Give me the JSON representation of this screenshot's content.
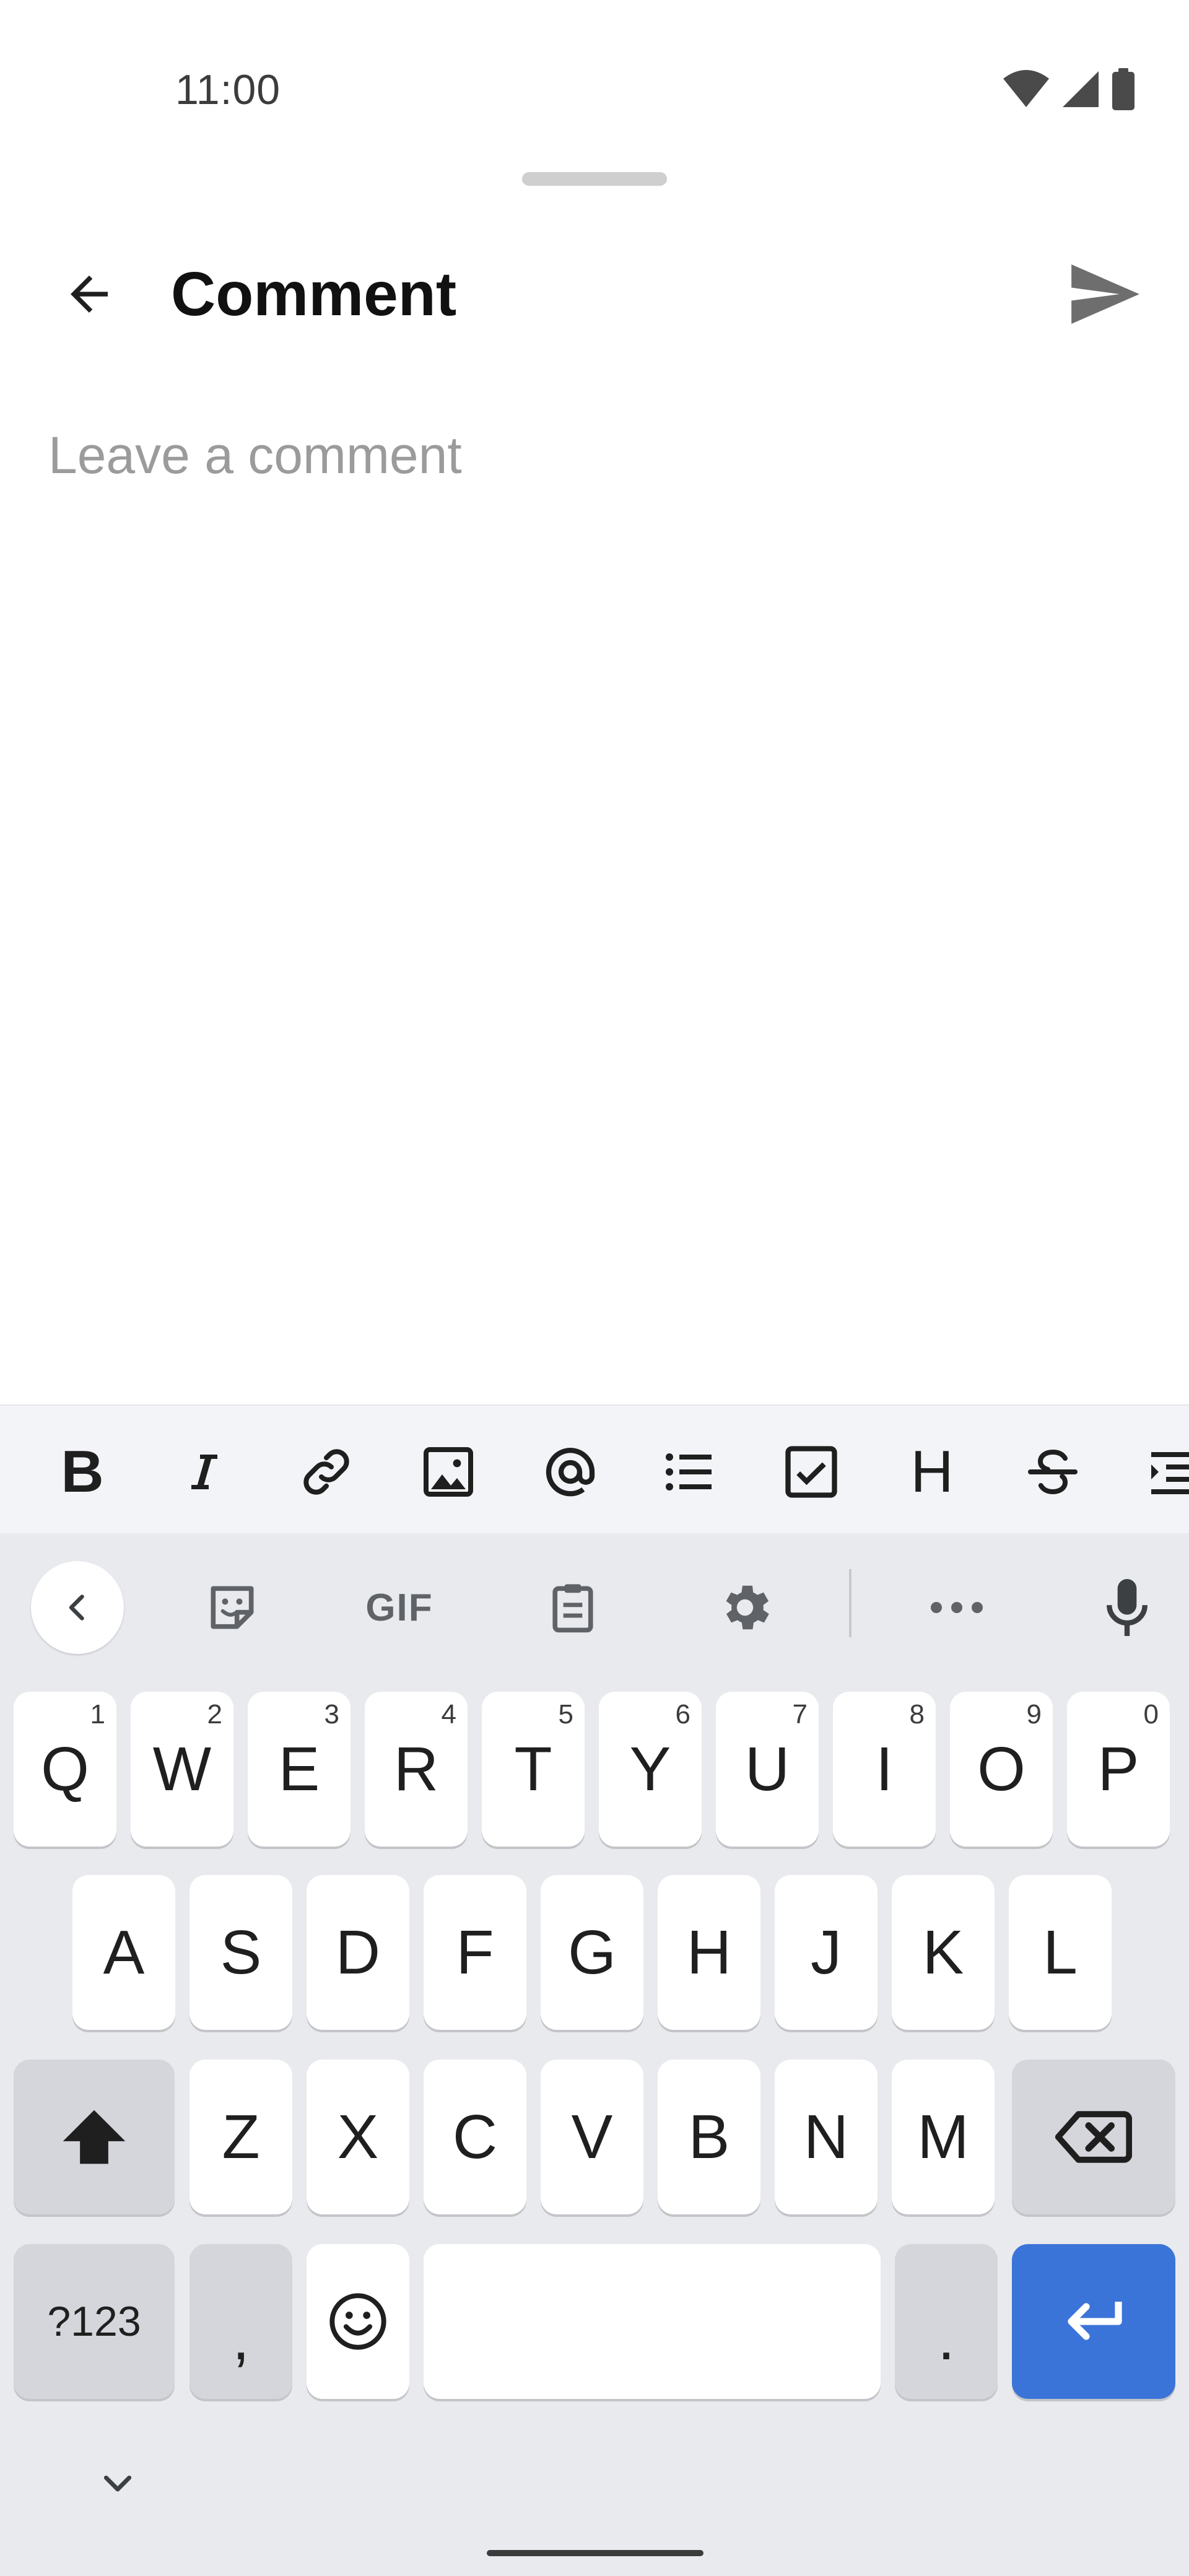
{
  "status_bar": {
    "time": "11:00",
    "icons": [
      "wifi-icon",
      "signal-icon",
      "battery-icon"
    ]
  },
  "header": {
    "title": "Comment",
    "back_icon": "arrow-back-icon",
    "send_icon": "send-icon"
  },
  "editor": {
    "value": "",
    "placeholder": "Leave a comment"
  },
  "format_toolbar": {
    "items": [
      "bold-icon",
      "italic-icon",
      "link-icon",
      "image-icon",
      "mention-icon",
      "bullet-list-icon",
      "checkbox-icon",
      "heading-icon",
      "strikethrough-icon",
      "indent-icon"
    ],
    "bold_glyph": "B",
    "heading_glyph": "H"
  },
  "keyboard": {
    "suggestion_strip": {
      "items": [
        "collapse-icon",
        "sticker-icon",
        "gif-label",
        "clipboard-icon",
        "settings-icon",
        "more-icon",
        "microphone-icon"
      ],
      "gif_label": "GIF"
    },
    "row1": [
      {
        "label": "Q",
        "hint": "1"
      },
      {
        "label": "W",
        "hint": "2"
      },
      {
        "label": "E",
        "hint": "3"
      },
      {
        "label": "R",
        "hint": "4"
      },
      {
        "label": "T",
        "hint": "5"
      },
      {
        "label": "Y",
        "hint": "6"
      },
      {
        "label": "U",
        "hint": "7"
      },
      {
        "label": "I",
        "hint": "8"
      },
      {
        "label": "O",
        "hint": "9"
      },
      {
        "label": "P",
        "hint": "0"
      }
    ],
    "row2": [
      "A",
      "S",
      "D",
      "F",
      "G",
      "H",
      "J",
      "K",
      "L"
    ],
    "row3": [
      "Z",
      "X",
      "C",
      "V",
      "B",
      "N",
      "M"
    ],
    "symbols_label": "?123",
    "comma_label": ",",
    "period_label": ".",
    "icons": [
      "shift-icon",
      "backspace-icon",
      "emoji-icon",
      "enter-icon",
      "hide-keyboard-icon"
    ],
    "colors": {
      "enter_key": "#3b74d9",
      "function_key": "#d5d6db",
      "background": "#e9eaee"
    }
  }
}
